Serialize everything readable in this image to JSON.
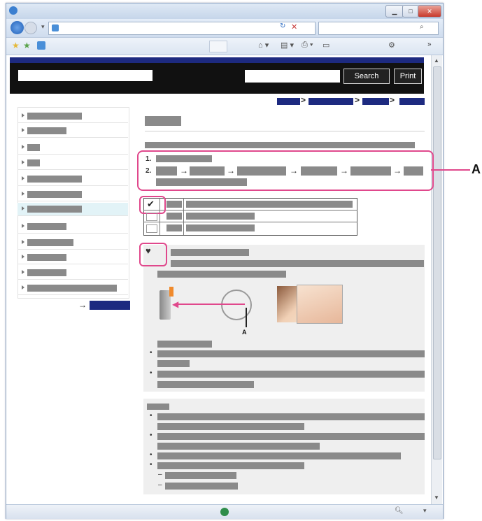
{
  "header": {
    "search_button": "Search",
    "print_button": "Print"
  },
  "browser": {
    "window_controls": [
      "minimize-icon",
      "maximize-icon",
      "close-icon"
    ]
  },
  "steps": {
    "step1_number": "1.",
    "step2_number": "2.",
    "arrow": "→"
  },
  "callout": {
    "outer_label": "A",
    "diagram_label": "A"
  },
  "tip_list": {
    "bullet": "•",
    "dash": "–"
  },
  "sidebar": {
    "next_arrow": "→",
    "highlight_color": "#e2f3f7"
  },
  "colors": {
    "brand_navy": "#1d2a80",
    "callout_pink": "#e0488c"
  }
}
